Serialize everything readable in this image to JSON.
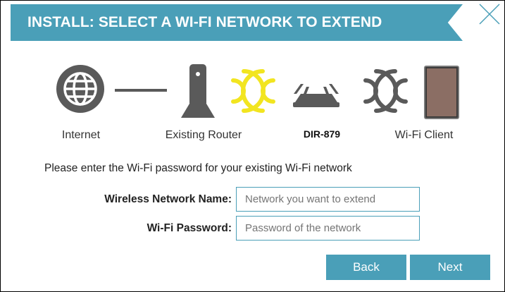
{
  "dialog": {
    "title": "INSTALL: SELECT A WI-FI NETWORK TO EXTEND",
    "close_icon": "close-icon"
  },
  "diagram": {
    "internet_label": "Internet",
    "router_label": "Existing Router",
    "device_label": "DIR-879",
    "client_label": "Wi-Fi Client",
    "icons": [
      "globe-icon",
      "router-icon",
      "wifi-waves-icon",
      "extender-icon",
      "wifi-waves-icon",
      "tablet-icon"
    ],
    "colors": {
      "accent": "#4a9fb8",
      "wifi_yellow": "#f2e520",
      "icon_gray": "#5a5a5a"
    }
  },
  "form": {
    "instruction": "Please enter the Wi-Fi password for your existing Wi-Fi network",
    "network_name_label": "Wireless Network Name:",
    "network_name_placeholder": "Network you want to extend",
    "password_label": "Wi-Fi Password:",
    "password_placeholder": "Password of the network"
  },
  "buttons": {
    "back_label": "Back",
    "next_label": "Next"
  }
}
